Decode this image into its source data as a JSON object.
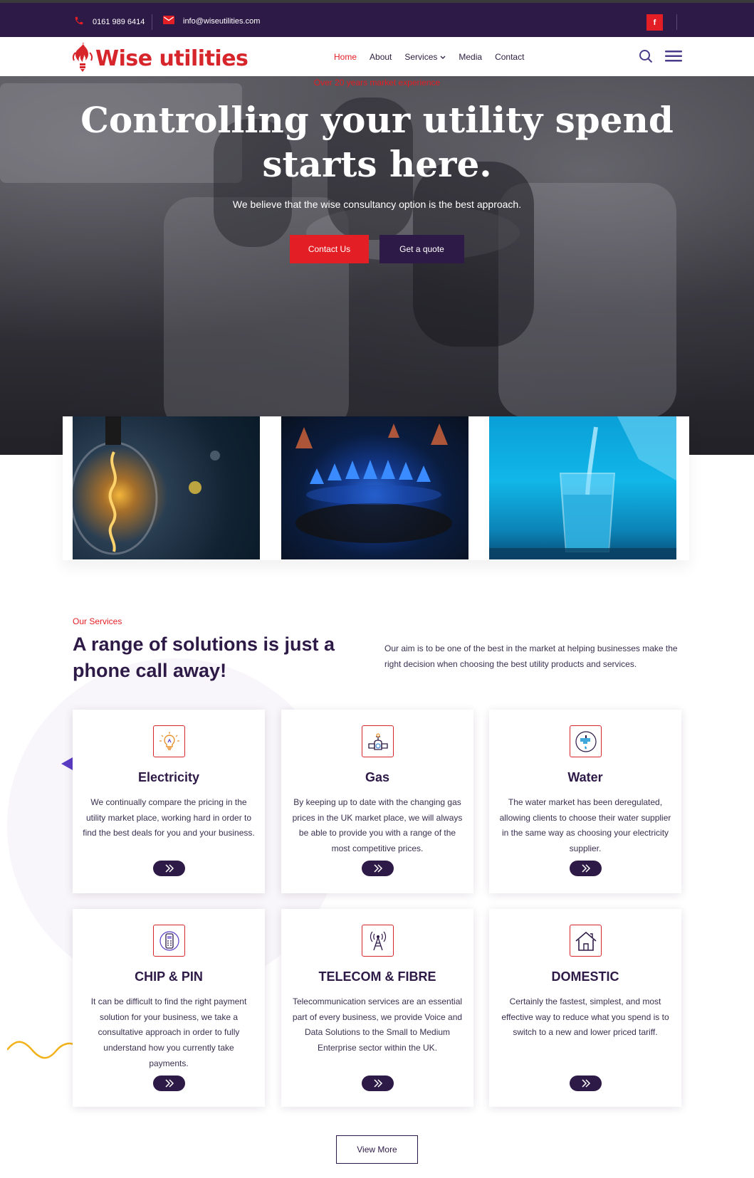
{
  "topbar": {
    "phone": "0161 989 6414",
    "email": "info@wiseutilities.com",
    "facebook_icon": "facebook-icon"
  },
  "header": {
    "logo_text": "Wise utilities",
    "nav": [
      {
        "label": "Home",
        "active": true
      },
      {
        "label": "About"
      },
      {
        "label": "Services",
        "has_dropdown": true
      },
      {
        "label": "Media"
      },
      {
        "label": "Contact"
      }
    ],
    "icons": [
      "search-icon",
      "hamburger-menu-icon"
    ]
  },
  "hero": {
    "eyebrow": "Over 20 years market experience",
    "title_line1": "Controlling your utility spend",
    "title_line2": "starts here.",
    "subtitle": "We believe that the wise consultancy option is the best approach.",
    "btn_contact": "Contact Us",
    "btn_quote": "Get a quote"
  },
  "feature_images": [
    "light-bulb",
    "gas-flame",
    "glass-of-water"
  ],
  "services": {
    "eyebrow": "Our Services",
    "title": "A range of solutions is just a phone call away!",
    "description": "Our aim is to be one of the best in the market at helping businesses make the right decision when choosing the best utility products and services.",
    "cards": [
      {
        "icon": "lightbulb-icon",
        "title": "Electricity",
        "text": "We continually compare the pricing in the utility market place, working hard in order to find the best deals for you and your business."
      },
      {
        "icon": "gas-pipe-icon",
        "title": "Gas",
        "text": "By keeping up to date with the changing gas prices in the UK market place, we will always be able to provide you with a range of the most competitive prices."
      },
      {
        "icon": "water-tap-icon",
        "title": "Water",
        "text": "The water market has been deregulated, allowing clients to choose their water supplier in the same way as choosing your electricity supplier."
      },
      {
        "icon": "card-terminal-icon",
        "title": "CHIP & PIN",
        "text": "It can be difficult to find the right payment solution for your business, we take a consultative approach in order to fully understand how you currently take payments."
      },
      {
        "icon": "antenna-tower-icon",
        "title": "TELECOM & FIBRE",
        "text": "Telecommunication services are an essential part of every business, we provide Voice and Data Solutions to the Small to Medium Enterprise sector within the UK."
      },
      {
        "icon": "house-icon",
        "title": "DOMESTIC",
        "text": "Certainly the fastest, simplest, and most effective way to reduce what you spend is to switch to a new and lower priced tariff."
      }
    ],
    "view_more": "View More"
  },
  "colors": {
    "brand_purple": "#2e1a47",
    "brand_red": "#e31e24"
  }
}
